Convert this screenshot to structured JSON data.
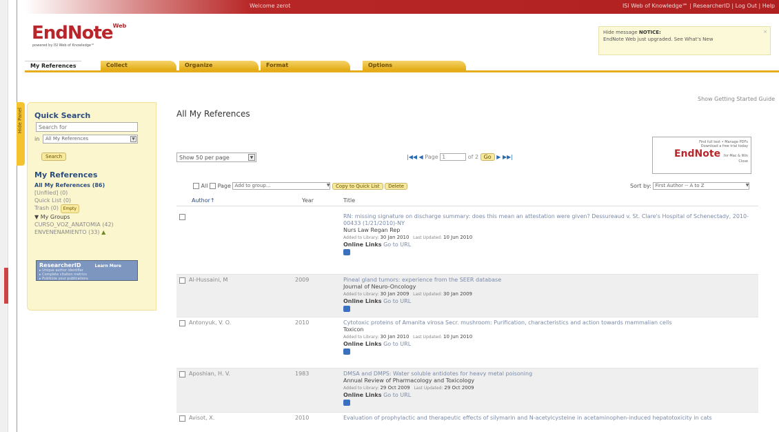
{
  "topbar": {
    "welcome": "Welcome zerot",
    "links": "ISI Web of Knowledge℠ | ResearcherID | Log Out | Help"
  },
  "logo": {
    "text": "EndNote",
    "sup": "Web",
    "powered": "powered by ISI Web of Knowledge℠",
    "colors": {
      "brand": "#b8262b"
    }
  },
  "notice": {
    "line1_prefix": "Hide message",
    "line1_bold": "NOTICE:",
    "line2": "EndNote Web just upgraded. See What's New"
  },
  "tabs": [
    "My References",
    "Collect",
    "Organize",
    "Format",
    "Options"
  ],
  "getting_started": "Show Getting Started Guide",
  "hide_panel": "Hide Panel",
  "quick_search": {
    "title": "Quick Search",
    "placeholder": "Search for",
    "in_label": "in",
    "scope": "All My References",
    "button": "Search"
  },
  "my_references": {
    "title": "My References",
    "items": [
      {
        "label": "All My References (86)",
        "highlight": true
      },
      {
        "label": "[Unfiled] (0)"
      },
      {
        "label": "Quick List (0)"
      },
      {
        "label": "Trash (0)",
        "button": "Empty"
      },
      {
        "label": "▼ My Groups"
      },
      {
        "label": "CURSO_VOZ_ANATOMIA (42)"
      },
      {
        "label": "ENVENENAMIENTO (33)"
      }
    ]
  },
  "researcher_id": {
    "title": "ResearcherID",
    "learn_more": "Learn More",
    "lines": [
      "▸ Unique author identifier",
      "▸ Complete citation metrics",
      "▸ Publicize your publications"
    ]
  },
  "content_title": "All My References",
  "show_per_page": "Show 50 per page",
  "pager": {
    "page_label": "Page",
    "page_value": "1",
    "of": "of 2",
    "go": "Go"
  },
  "ad": {
    "line1": "Find full text • Manage PDFs",
    "line2": "Download a free trial today",
    "brand": "EndNote",
    "brand_suffix": "for Mac & Win",
    "line3": "Close"
  },
  "toolbar": {
    "all": "All",
    "page": "Page",
    "add_to_group": "Add to group...",
    "copy_quick_list": "Copy to Quick List",
    "delete": "Delete",
    "sort_by": "Sort by:",
    "sort_value": "First Author -- A to Z"
  },
  "table_headers": {
    "author": "Author↑",
    "year": "Year",
    "title": "Title"
  },
  "references": [
    {
      "author": "",
      "year": "",
      "title": "RN: missing signature on discharge summary: does this mean an attestation were given? Dessureaud v. St. Clare's Hospital of Schenectady, 2010-00433 (1/21/2010)-NY",
      "journal": "Nurs Law Regan Rep",
      "added": "30 Jan 2010",
      "updated": "10 Jun 2010",
      "online": "Online Links",
      "url": "Go to URL"
    },
    {
      "author": "Al-Hussaini, M",
      "year": "2009",
      "title": "Pineal gland tumors: experience from the SEER database",
      "journal": "Journal of Neuro-Oncology",
      "added": "30 Jan 2009",
      "updated": "30 Jan 2009",
      "online": "Online Links",
      "url": "Go to URL"
    },
    {
      "author": "Antonyuk, V. O.",
      "year": "2010",
      "title": "Cytotoxic proteins of Amanita virosa Secr. mushroom: Purification, characteristics and action towards mammalian cells",
      "journal": "Toxicon",
      "added": "30 Jan 2010",
      "updated": "10 Jun 2010",
      "online": "Online Links",
      "url": "Go to URL"
    },
    {
      "author": "Aposhian, H. V.",
      "year": "1983",
      "title": "DMSA and DMPS: Water soluble antidotes for heavy metal poisoning",
      "journal": "Annual Review of Pharmacology and Toxicology",
      "added": "29 Oct 2009",
      "updated": "29 Oct 2009",
      "online": "Online Links",
      "url": "Go to URL"
    },
    {
      "author": "Avisot, X.",
      "year": "2010",
      "title": "Evaluation of prophylactic and therapeutic effects of silymarin and N-acetylcysteine in acetaminophen-induced hepatotoxicity in cats",
      "journal": "",
      "added": "",
      "updated": "",
      "online": "",
      "url": ""
    }
  ],
  "labels": {
    "added": "Added to Library:",
    "updated": "Last Updated:"
  }
}
